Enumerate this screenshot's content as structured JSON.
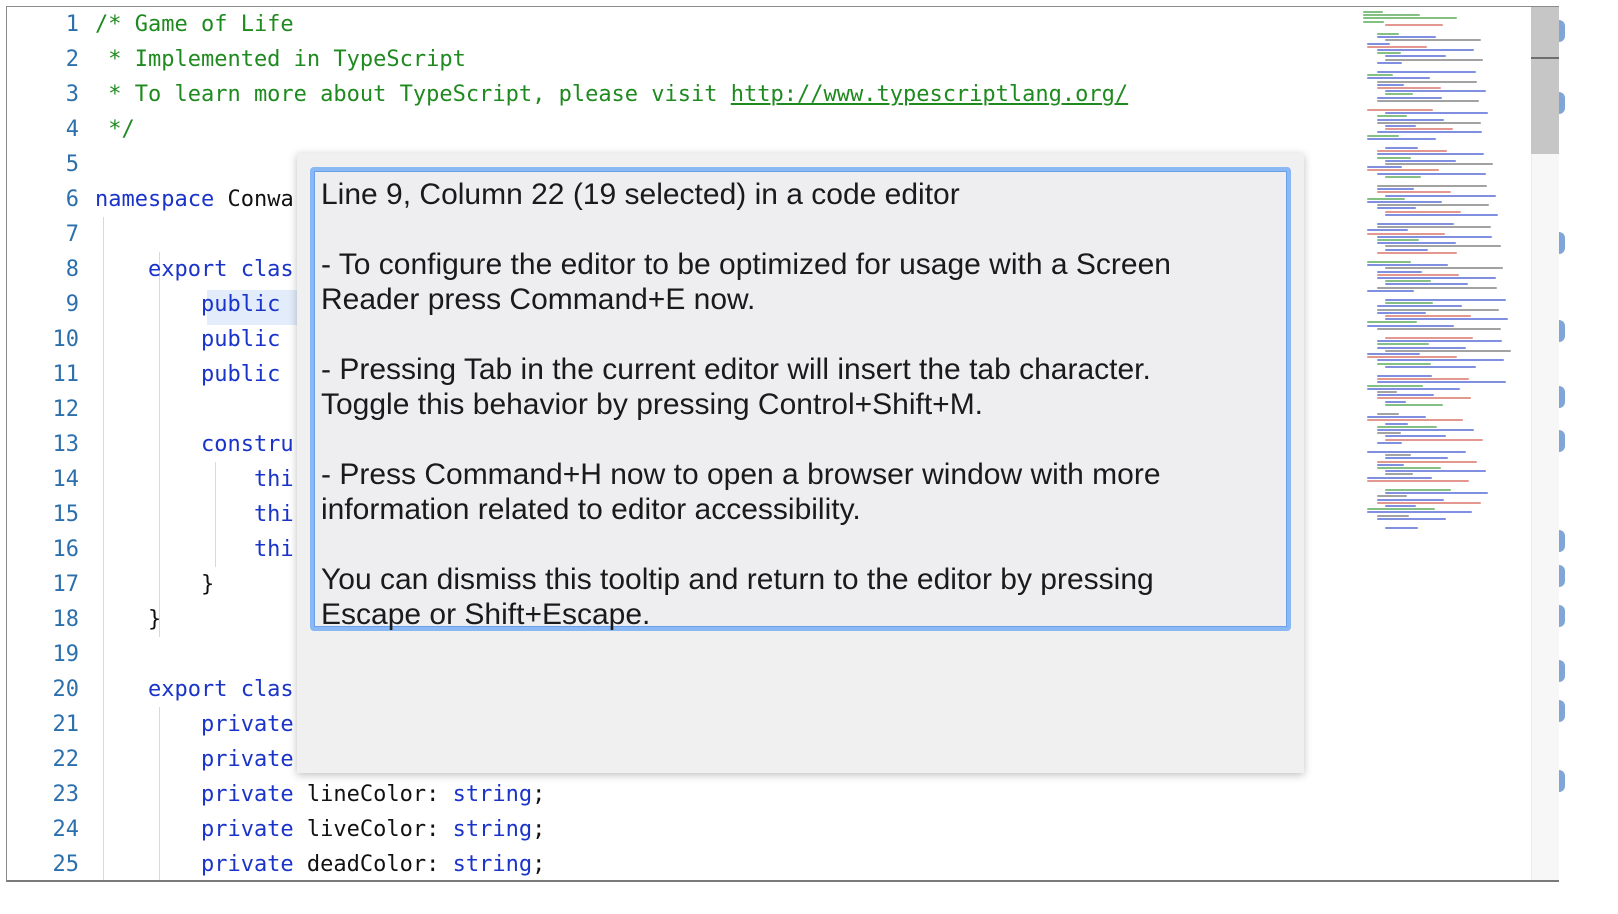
{
  "editor": {
    "line_numbers": [
      "1",
      "2",
      "3",
      "4",
      "5",
      "6",
      "7",
      "8",
      "9",
      "10",
      "11",
      "12",
      "13",
      "14",
      "15",
      "16",
      "17",
      "18",
      "19",
      "20",
      "21",
      "22",
      "23",
      "24",
      "25"
    ],
    "lines": [
      {
        "parts": [
          {
            "t": "/* Game of Life",
            "c": "comment"
          }
        ]
      },
      {
        "parts": [
          {
            "t": " * Implemented in TypeScript",
            "c": "comment"
          }
        ]
      },
      {
        "parts": [
          {
            "t": " * To learn more about TypeScript, please visit ",
            "c": "comment"
          },
          {
            "t": "http://www.typescriptlang.org/",
            "c": "comment link"
          }
        ]
      },
      {
        "parts": [
          {
            "t": " */",
            "c": "comment"
          }
        ]
      },
      {
        "parts": []
      },
      {
        "parts": [
          {
            "t": "namespace",
            "c": "kw"
          },
          {
            "t": " Conwa",
            "c": "plain"
          }
        ]
      },
      {
        "parts": []
      },
      {
        "parts": [
          {
            "t": "    export clas",
            "c": "kw"
          }
        ]
      },
      {
        "parts": [
          {
            "t": "        public",
            "c": "kw"
          }
        ]
      },
      {
        "parts": [
          {
            "t": "        public",
            "c": "kw"
          }
        ]
      },
      {
        "parts": [
          {
            "t": "        public",
            "c": "kw"
          }
        ]
      },
      {
        "parts": []
      },
      {
        "parts": [
          {
            "t": "        constru",
            "c": "kw"
          }
        ]
      },
      {
        "parts": [
          {
            "t": "            thi",
            "c": "kw"
          }
        ]
      },
      {
        "parts": [
          {
            "t": "            thi",
            "c": "kw"
          }
        ]
      },
      {
        "parts": [
          {
            "t": "            thi",
            "c": "kw"
          }
        ]
      },
      {
        "parts": [
          {
            "t": "        }",
            "c": "plain"
          }
        ]
      },
      {
        "parts": [
          {
            "t": "    }",
            "c": "plain"
          }
        ]
      },
      {
        "parts": []
      },
      {
        "parts": [
          {
            "t": "    export clas",
            "c": "kw"
          }
        ]
      },
      {
        "parts": [
          {
            "t": "        private",
            "c": "kw"
          }
        ]
      },
      {
        "parts": [
          {
            "t": "        private",
            "c": "kw"
          }
        ]
      },
      {
        "parts": [
          {
            "t": "        private",
            "c": "kw"
          },
          {
            "t": " lineColor: ",
            "c": "plain"
          },
          {
            "t": "string",
            "c": "kw"
          },
          {
            "t": ";",
            "c": "plain"
          }
        ]
      },
      {
        "parts": [
          {
            "t": "        private",
            "c": "kw"
          },
          {
            "t": " liveColor: ",
            "c": "plain"
          },
          {
            "t": "string",
            "c": "kw"
          },
          {
            "t": ";",
            "c": "plain"
          }
        ]
      },
      {
        "parts": [
          {
            "t": "        private",
            "c": "kw"
          },
          {
            "t": " deadColor: ",
            "c": "plain"
          },
          {
            "t": "string",
            "c": "kw"
          },
          {
            "t": ";",
            "c": "plain"
          }
        ]
      }
    ]
  },
  "tooltip": {
    "heading": "Line 9, Column 22 (19 selected) in a code editor",
    "lines": [
      "- To configure the editor to be optimized for usage with a Screen",
      "Reader press Command+E now.",
      "- Pressing Tab in the current editor will insert the tab character.",
      "Toggle this behavior by pressing Control+Shift+M.",
      "- Press Command+H now to open a browser window with more",
      "information related to editor accessibility.",
      "You can dismiss this tooltip and return to the editor by pressing",
      "Escape or Shift+Escape."
    ]
  },
  "colors": {
    "comment": "#1f8a1f",
    "keyword": "#1a33c8",
    "line_number": "#2b6fad",
    "focus_border": "#8ab8f5"
  }
}
